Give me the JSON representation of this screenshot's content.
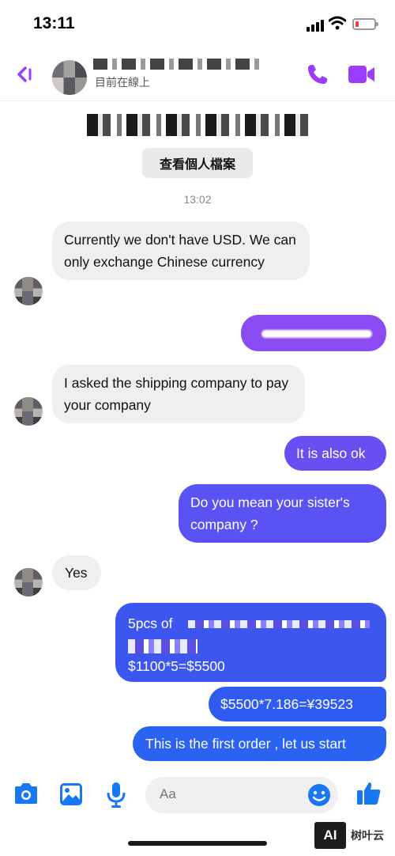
{
  "status_bar": {
    "time": "13:11"
  },
  "header": {
    "status": "目前在線上"
  },
  "profile": {
    "view_profile_label": "查看個人檔案"
  },
  "timestamp": "13:02",
  "messages": [
    {
      "direction": "in",
      "text": "Currently we don't have USD. We can only exchange Chinese currency"
    },
    {
      "direction": "out",
      "text": ""
    },
    {
      "direction": "in",
      "text": "I asked the shipping company to pay your company"
    },
    {
      "direction": "out",
      "text": "It is also ok"
    },
    {
      "direction": "out",
      "text": "Do you mean your sister's company ?"
    },
    {
      "direction": "in",
      "text": "Yes"
    },
    {
      "direction": "out",
      "text_start": "5pcs of",
      "text_end": "$1100*5=$5500"
    },
    {
      "direction": "out",
      "text": "$5500*7.186=¥39523"
    },
    {
      "direction": "out",
      "text": "This is the first order , let us start"
    }
  ],
  "composer": {
    "placeholder": "Aa"
  },
  "watermark": {
    "logo": "AI",
    "text": "树叶云"
  },
  "colors": {
    "accent": "#9b3dff",
    "bubble_purple": "#8a4cf2",
    "bubble_indigo": "#5a52f2",
    "bubble_blue": "#2f5bf0",
    "messenger_blue": "#1877f2"
  }
}
